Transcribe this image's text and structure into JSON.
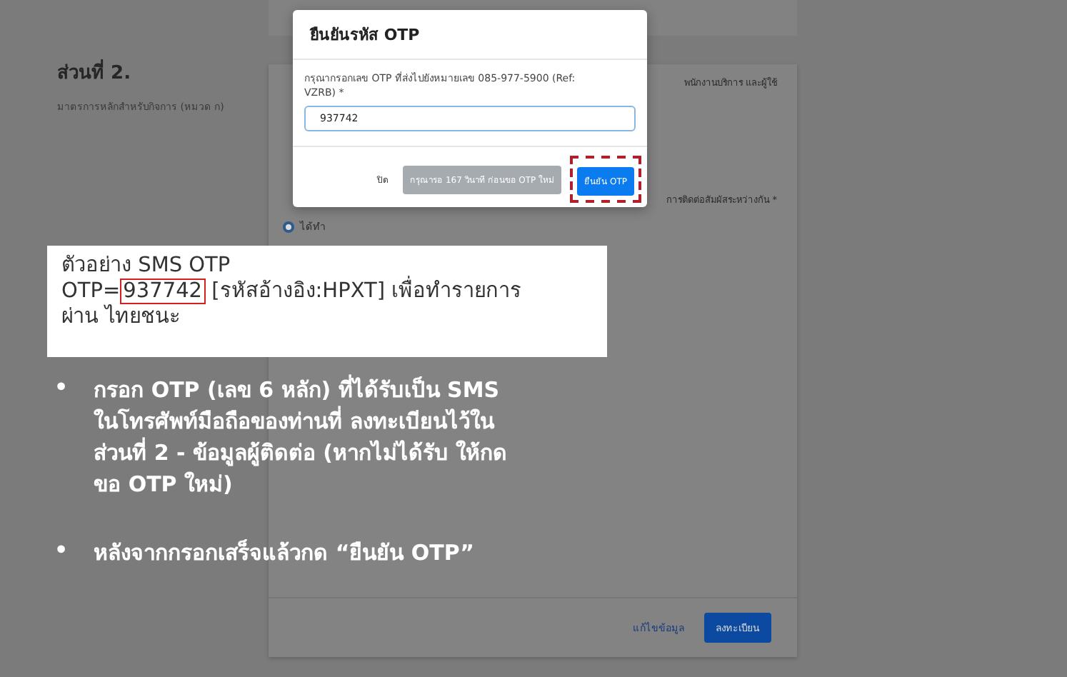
{
  "section": {
    "title": "ส่วนที่ 2.",
    "subtitle": "มาตรการหลักสำหรับกิจการ (หมวด ก)"
  },
  "card": {
    "lines": [
      {
        "kind": "fragment",
        "text": "พนักงานบริการ และผู้ใช้"
      },
      {
        "kind": "fragment",
        "text": "การติดต่อสัมผัสระหว่างกัน *"
      },
      {
        "kind": "radio",
        "text": "ได้ทำ",
        "selected": true
      }
    ],
    "edit_link": "แก้ไขข้อมูล",
    "submit_button": "ลงทะเบียน"
  },
  "modal": {
    "title": "ยืนยันรหัส OTP",
    "label": "กรุณากรอกเลข OTP ที่ส่งไปยังหมายเลข 085-977-5900 (Ref: VZRB) *",
    "value": "937742",
    "buttons": [
      {
        "kind": "link",
        "label": "ปิด",
        "disabled": false,
        "highlighted": false
      },
      {
        "kind": "secondary",
        "label": "กรุณารอ 167 วินาที ก่อนขอ OTP ใหม่",
        "disabled": true,
        "highlighted": false
      },
      {
        "kind": "primary",
        "label": "ยืนยัน OTP",
        "disabled": false,
        "highlighted": true
      }
    ]
  },
  "sms_example": {
    "title": "ตัวอย่าง SMS OTP",
    "prefix": "OTP=",
    "code": "937742",
    "suffix": "[รหัสอ้างอิง:HPXT] เพื่อทำรายการ ผ่าน ไทยชนะ"
  },
  "instructions": [
    {
      "bullet": "•",
      "text": "กรอก OTP (เลข 6 หลัก) ที่ได้รับเป็น SMS ในโทรศัพท์มือถือของท่านที่ ลงทะเบียนไว้ในส่วนที่ 2 - ข้อมูลผู้ติดต่อ (หากไม่ได้รับ ให้กดขอ OTP ใหม่)"
    },
    {
      "bullet": "•",
      "text": "หลังจากกรอกเสร็จแล้วกด “ยืนยัน OTP”"
    }
  ]
}
